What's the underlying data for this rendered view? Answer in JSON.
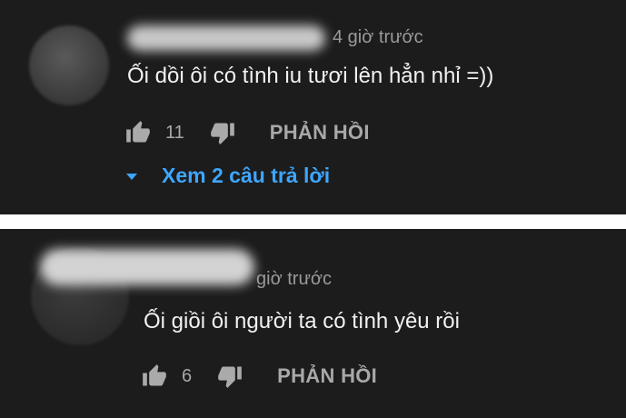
{
  "comments": [
    {
      "time": "4 giờ trước",
      "text": "Ối dồi ôi có tình iu tươi lên hẳn nhỉ =))",
      "likes": "11",
      "reply_label": "PHẢN HỒI",
      "view_replies": "Xem 2 câu trả lời",
      "icons": {
        "like": "thumbs-up",
        "dislike": "thumbs-down",
        "expand": "caret-down"
      }
    },
    {
      "time": "giờ trước",
      "text": "Ối giồi ôi người ta có tình yêu rồi",
      "likes": "6",
      "reply_label": "PHẢN HỒI",
      "icons": {
        "like": "thumbs-up",
        "dislike": "thumbs-down"
      }
    }
  ],
  "colors": {
    "background": "#1c1c1c",
    "primary_text": "#f1f1f1",
    "secondary_text": "#aaaaaa",
    "link": "#3ea6ff"
  }
}
